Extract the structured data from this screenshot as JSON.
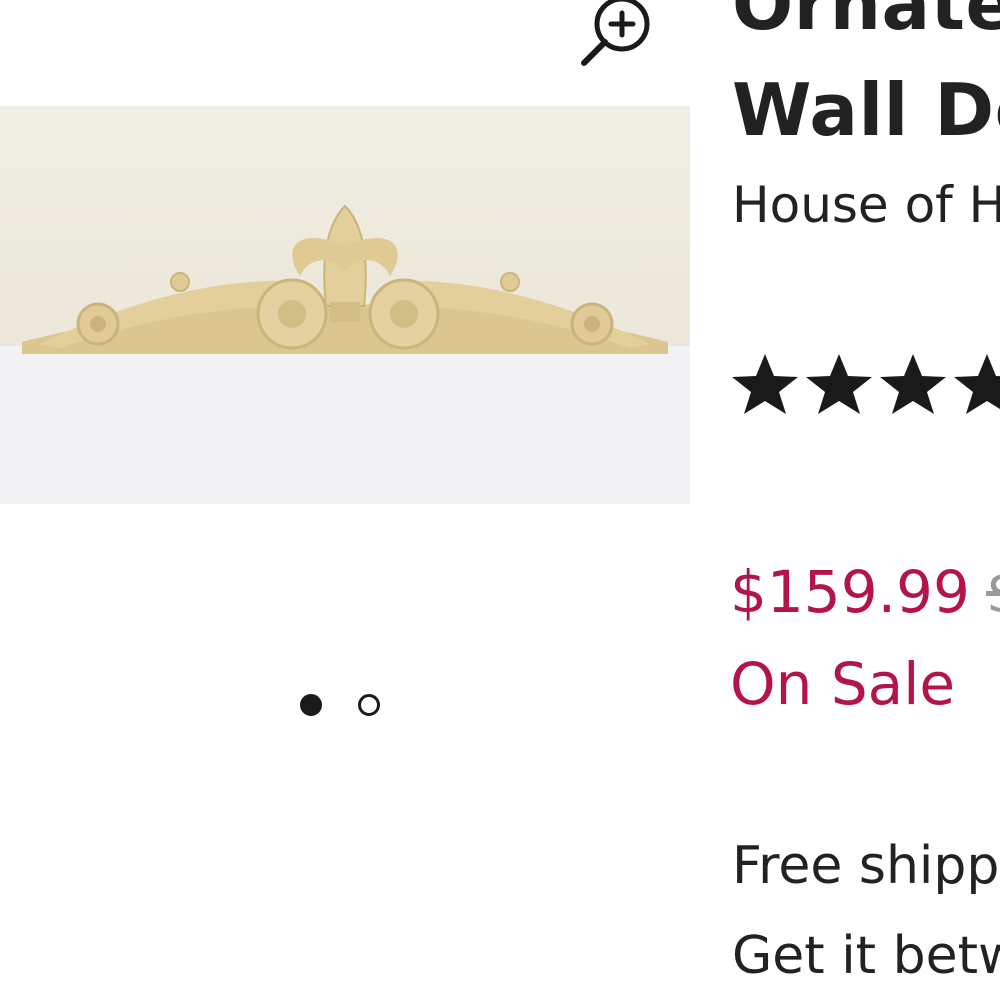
{
  "gallery": {
    "zoom_icon": "zoom-in-icon",
    "image_alt": "ornate carved pediment wall decor",
    "dots": [
      {
        "state": "active"
      },
      {
        "state": "inactive"
      }
    ]
  },
  "product": {
    "title_line1": "Ornate",
    "title_line2": "Wall Dé",
    "brand": "House of H",
    "rating_stars_visible": 4,
    "star_icon": "star-icon",
    "price": "$159.99",
    "original_price_partial": "$",
    "sale_label": "On Sale",
    "shipping_text": "Free shipp",
    "delivery_text": "Get it betw"
  },
  "colors": {
    "sale_accent": "#b3144d",
    "text": "#222222",
    "image_wall": "#f1eee4",
    "image_shelf": "#f2f2f4",
    "carving": "#e3cf9c"
  }
}
